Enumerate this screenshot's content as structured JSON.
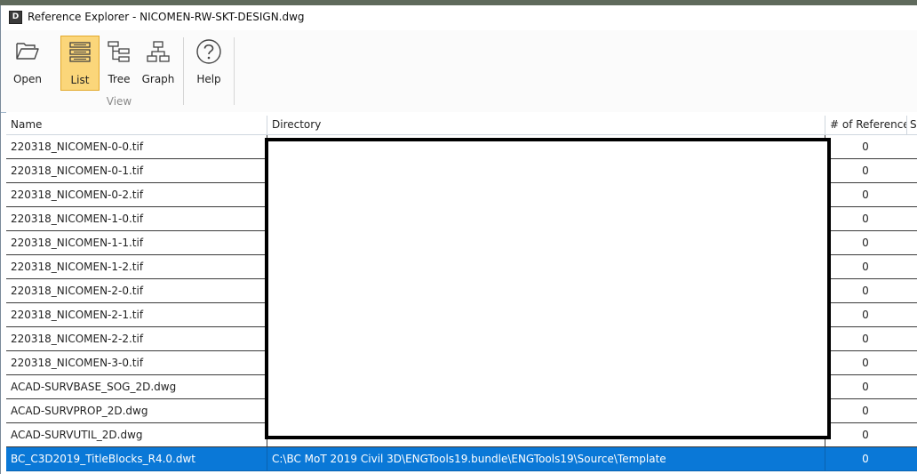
{
  "window": {
    "title": "Reference Explorer - NICOMEN-RW-SKT-DESIGN.dwg",
    "app_icon": "D"
  },
  "ribbon": {
    "buttons": {
      "open": "Open",
      "list": "List",
      "tree": "Tree",
      "graph": "Graph",
      "help": "Help"
    },
    "group_view": "View"
  },
  "grid": {
    "columns": [
      "Name",
      "Directory",
      "# of References",
      "St"
    ],
    "rows": [
      {
        "name": "220318_NICOMEN-0-0.tif",
        "directory": "",
        "refs": "0"
      },
      {
        "name": "220318_NICOMEN-0-1.tif",
        "directory": "",
        "refs": "0"
      },
      {
        "name": "220318_NICOMEN-0-2.tif",
        "directory": "",
        "refs": "0"
      },
      {
        "name": "220318_NICOMEN-1-0.tif",
        "directory": "",
        "refs": "0"
      },
      {
        "name": "220318_NICOMEN-1-1.tif",
        "directory": "",
        "refs": "0"
      },
      {
        "name": "220318_NICOMEN-1-2.tif",
        "directory": "",
        "refs": "0"
      },
      {
        "name": "220318_NICOMEN-2-0.tif",
        "directory": "",
        "refs": "0"
      },
      {
        "name": "220318_NICOMEN-2-1.tif",
        "directory": "",
        "refs": "0"
      },
      {
        "name": "220318_NICOMEN-2-2.tif",
        "directory": "",
        "refs": "0"
      },
      {
        "name": "220318_NICOMEN-3-0.tif",
        "directory": "",
        "refs": "0"
      },
      {
        "name": "ACAD-SURVBASE_SOG_2D.dwg",
        "directory": "",
        "refs": "0"
      },
      {
        "name": "ACAD-SURVPROP_2D.dwg",
        "directory": "",
        "refs": "0"
      },
      {
        "name": "ACAD-SURVUTIL_2D.dwg",
        "directory": "",
        "refs": "0"
      },
      {
        "name": "BC_C3D2019_TitleBlocks_R4.0.dwt",
        "directory": "C:\\BC MoT 2019 Civil 3D\\ENGTools19.bundle\\ENGTools19\\Source\\Template",
        "refs": "0",
        "selected": true
      }
    ]
  }
}
